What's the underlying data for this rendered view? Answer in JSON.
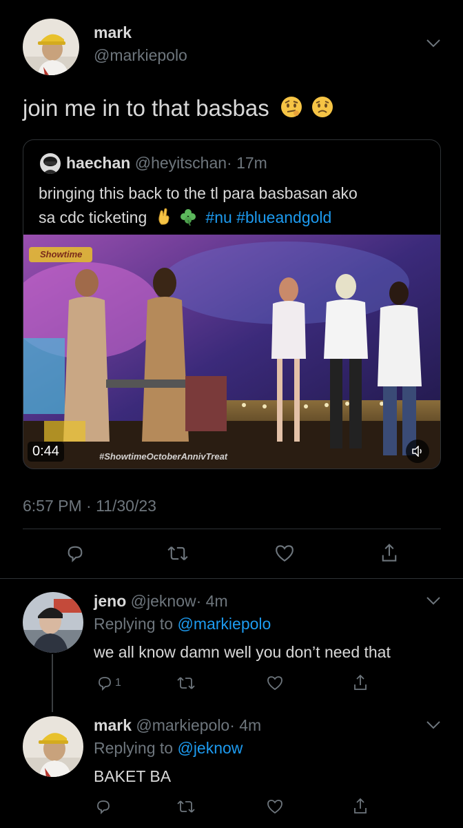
{
  "main_tweet": {
    "name": "mark",
    "handle": "@markiepolo",
    "text": "join me in to that basbas",
    "emoji_names": [
      "face-with-raised-eyebrow",
      "worried-face"
    ],
    "timestamp": "6:57 PM · 11/30/23"
  },
  "quoted_tweet": {
    "name": "haechan",
    "handle": "@heyitschan",
    "time": "· 17m",
    "line1": "bringing this back to the tl para basbasan ako",
    "line2_text": "sa cdc ticketing",
    "emoji_names": [
      "crossed-fingers",
      "four-leaf-clover"
    ],
    "hashtags": "#nu #blueandgold",
    "video": {
      "duration": "0:44",
      "caption": "#ShowtimeOctoberAnnivTreat",
      "channel_logo": "Showtime"
    }
  },
  "replies": [
    {
      "name": "jeno",
      "handle": "@jeknow",
      "time": "· 4m",
      "replying_prefix": "Replying to",
      "replying_to": "@markiepolo",
      "text": "we all know damn well you don’t need that",
      "reply_count": "1"
    },
    {
      "name": "mark",
      "handle": "@markiepolo",
      "time": "· 4m",
      "replying_prefix": "Replying to",
      "replying_to": "@jeknow",
      "text": "BAKET BA"
    }
  ],
  "colors": {
    "background": "#000000",
    "text": "#d9d9d9",
    "secondary": "#6e767d",
    "link": "#1d9bf0",
    "divider": "#2f3336"
  },
  "icons": [
    "reply-icon",
    "retweet-icon",
    "like-icon",
    "share-icon",
    "chevron-down-icon",
    "volume-icon"
  ]
}
